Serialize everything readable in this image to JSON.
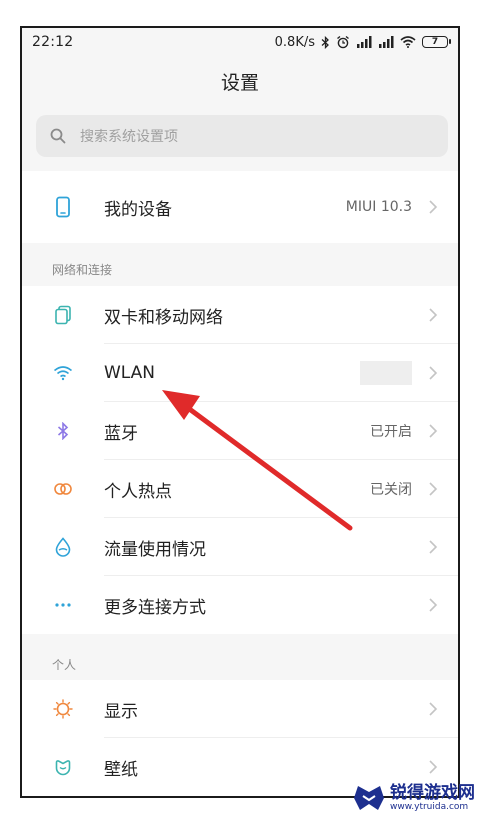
{
  "status_bar": {
    "time": "22:12",
    "speed": "0.8K/s",
    "battery": "7"
  },
  "header": {
    "title": "设置"
  },
  "search": {
    "placeholder": "搜索系统设置项"
  },
  "device": {
    "label": "我的设备",
    "value": "MIUI 10.3"
  },
  "sections": {
    "network": "网络和连接",
    "personal": "个人"
  },
  "network_items": [
    {
      "label": "双卡和移动网络",
      "value": "",
      "icon": "sim-icon"
    },
    {
      "label": "WLAN",
      "value": "",
      "icon": "wifi-icon"
    },
    {
      "label": "蓝牙",
      "value": "已开启",
      "icon": "bluetooth-icon"
    },
    {
      "label": "个人热点",
      "value": "已关闭",
      "icon": "hotspot-icon"
    },
    {
      "label": "流量使用情况",
      "value": "",
      "icon": "data-usage-icon"
    },
    {
      "label": "更多连接方式",
      "value": "",
      "icon": "more-icon"
    }
  ],
  "personal_items": [
    {
      "label": "显示",
      "icon": "display-icon"
    },
    {
      "label": "壁纸",
      "icon": "wallpaper-icon"
    }
  ],
  "watermark": {
    "title": "锐得游戏网",
    "url": "www.ytruida.com"
  },
  "colors": {
    "icon_blue": "#2fa3d8",
    "icon_teal": "#3cb4b0",
    "icon_purple": "#8d79e6",
    "icon_orange": "#f0883e",
    "arrow_red": "#e02a2a",
    "watermark_blue": "#1d2f8f"
  }
}
